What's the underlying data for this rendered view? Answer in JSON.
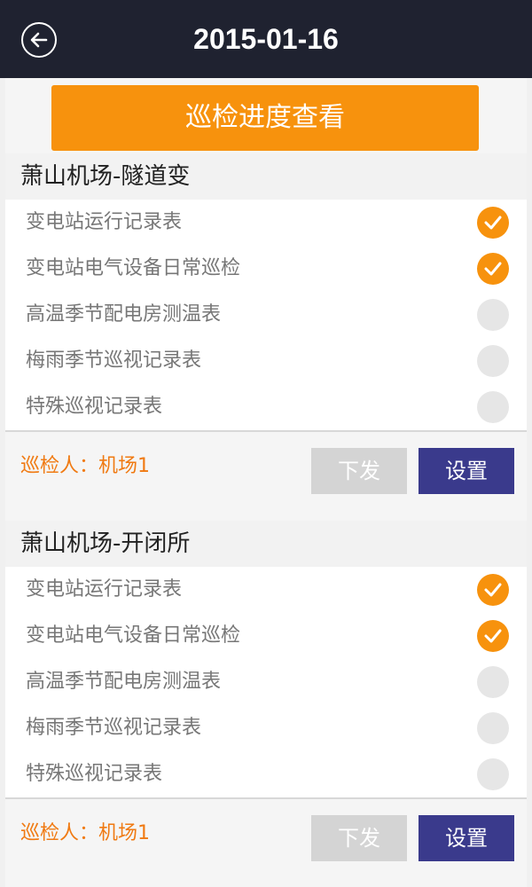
{
  "header": {
    "title": "2015-01-16",
    "back_icon": "back-arrow-icon"
  },
  "progress_button": "巡检进度查看",
  "sections": [
    {
      "title": "萧山机场-隧道变",
      "items": [
        {
          "label": "变电站运行记录表",
          "checked": true
        },
        {
          "label": "变电站电气设备日常巡检",
          "checked": true
        },
        {
          "label": "高温季节配电房测温表",
          "checked": false
        },
        {
          "label": "梅雨季节巡视记录表",
          "checked": false
        },
        {
          "label": "特殊巡视记录表",
          "checked": false
        }
      ],
      "inspector": "巡检人：机场1",
      "dispatch_label": "下发",
      "settings_label": "设置"
    },
    {
      "title": "萧山机场-开闭所",
      "items": [
        {
          "label": "变电站运行记录表",
          "checked": true
        },
        {
          "label": "变电站电气设备日常巡检",
          "checked": true
        },
        {
          "label": "高温季节配电房测温表",
          "checked": false
        },
        {
          "label": "梅雨季节巡视记录表",
          "checked": false
        },
        {
          "label": "特殊巡视记录表",
          "checked": false
        }
      ],
      "inspector": "巡检人：机场1",
      "dispatch_label": "下发",
      "settings_label": "设置"
    }
  ],
  "colors": {
    "header_bg": "#1f2230",
    "accent_orange": "#f7920d",
    "settings_blue": "#3a3a8c",
    "disabled_gray": "#d4d4d4"
  }
}
